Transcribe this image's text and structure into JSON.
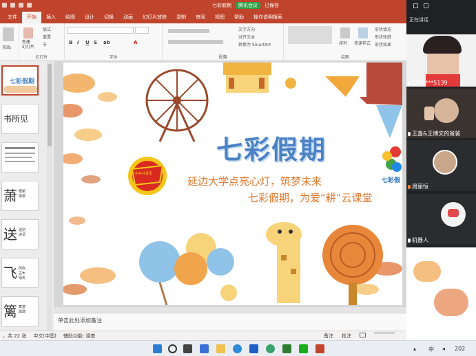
{
  "window": {
    "title_doc": "七彩假期",
    "meeting_pill": "腾讯会议",
    "title_suffix": "已保存"
  },
  "ribbon_tabs": [
    "文件",
    "插入",
    "绘图",
    "设计",
    "切换",
    "动画",
    "幻灯片放映",
    "录制",
    "审阅",
    "视图",
    "帮助",
    "操作说明搜索"
  ],
  "ribbon": {
    "clipboard_label": "剪贴板",
    "paste_label": "粘贴",
    "new_slide_label": "新建\n幻灯片",
    "slides_items": [
      "版式",
      "重置",
      "节"
    ],
    "slides_label": "幻灯片",
    "font_label": "字体",
    "paragraph_label": "段落",
    "text_dir_label": "文字方向",
    "align_text_label": "对齐文本",
    "smartart_label": "转换为 SmartArt",
    "drawing_label": "绘图",
    "arrange_label": "排列",
    "quick_styles_label": "快速样式",
    "shape_fill": "形状填充",
    "shape_outline": "形状轮廓",
    "shape_effect": "形状效果",
    "format_buttons": [
      "B",
      "I",
      "U",
      "S",
      "ab",
      "A"
    ]
  },
  "thumbnails": [
    {
      "num": "1",
      "title": "七彩假期",
      "big": "",
      "small": ""
    },
    {
      "num": "2",
      "title": "",
      "big": "书所见",
      "small": ""
    },
    {
      "num": "3",
      "title": "",
      "big": "",
      "small": ""
    },
    {
      "num": "4",
      "title": "",
      "big": "萧",
      "small": "梧桐\n萧萧"
    },
    {
      "num": "5",
      "title": "",
      "big": "送",
      "small": "送别\n诗词"
    },
    {
      "num": "6",
      "title": "",
      "big": "飞",
      "small": "风吹\n古木\n晴天"
    },
    {
      "num": "7",
      "title": "",
      "big": "篱",
      "small": "篱落\n疏疏"
    }
  ],
  "slide": {
    "title": "七彩假期",
    "line1": "延边大学点亮心灯，筑梦未来",
    "line2": "七彩假期，为爱“耕”云课堂",
    "badge_text": "中共共青团",
    "logo_text": "七彩假"
  },
  "notes": {
    "placeholder": "单击此处添加备注"
  },
  "status": {
    "slide_count": "，共 22 张",
    "language": "中文(中国)",
    "accessibility": "辅助功能: 调查",
    "notes_btn": "备注",
    "comments_btn": "批注"
  },
  "meeting": {
    "count": "正在讲话",
    "participants": [
      {
        "name": "189****5139",
        "muted": false
      },
      {
        "name": "王鑫&王博文的爸爸",
        "muted": false
      },
      {
        "name": "周丽恒",
        "muted": true
      },
      {
        "name": "机器人",
        "muted": false
      }
    ]
  },
  "taskbar": {
    "lang": "中",
    "clock": "202"
  },
  "colors": {
    "ppt_accent": "#c0442b",
    "title_blue": "#4a82c5",
    "subtitle_orange": "#e0792f"
  }
}
